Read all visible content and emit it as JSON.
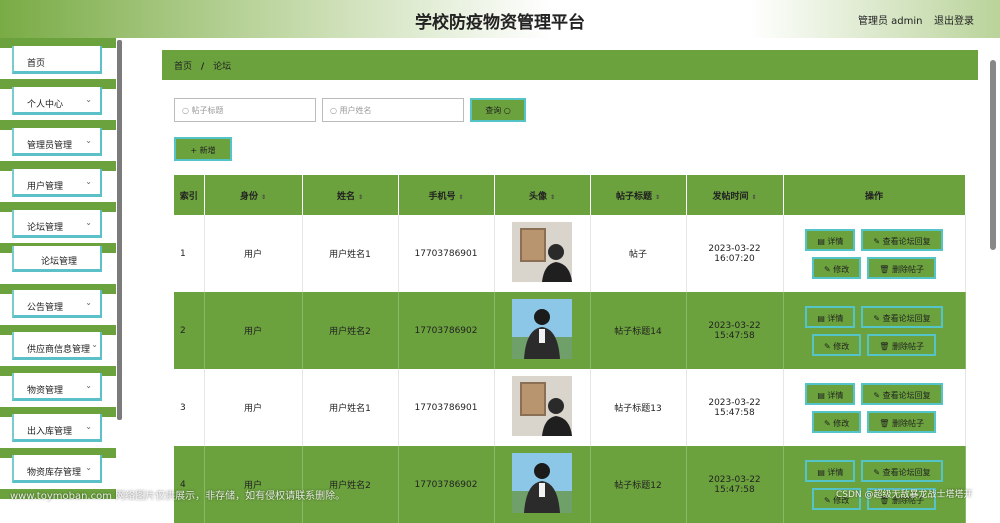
{
  "header": {
    "title": "学校防疫物资管理平台",
    "user": "管理员 admin",
    "logout": "退出登录"
  },
  "sidebar": {
    "items": [
      {
        "label": "首页"
      },
      {
        "label": "个人中心",
        "chev": "⌄"
      },
      {
        "label": "管理员管理",
        "chev": "⌄"
      },
      {
        "label": "用户管理",
        "chev": "⌄"
      },
      {
        "label": "论坛管理",
        "chev": "⌄"
      },
      {
        "label": "论坛管理"
      },
      {
        "label": "公告管理",
        "chev": "⌄"
      },
      {
        "label": "供应商信息管理",
        "chev": "⌄"
      },
      {
        "label": "物资管理",
        "chev": "⌄"
      },
      {
        "label": "出入库管理",
        "chev": "⌄"
      },
      {
        "label": "物资库存管理",
        "chev": "⌄"
      }
    ]
  },
  "breadcrumb": {
    "home": "首页",
    "sep": "/",
    "current": "论坛"
  },
  "search": {
    "title_placeholder": "帖子标题",
    "name_placeholder": "用户姓名",
    "query_label": "查询",
    "add_label": "+ 新增"
  },
  "table": {
    "headers": [
      "索引",
      "身份",
      "姓名",
      "手机号",
      "头像",
      "帖子标题",
      "发帖时间",
      "操作"
    ],
    "sort_icon": "⇕",
    "rows": [
      {
        "index": "1",
        "role": "用户",
        "name": "用户姓名1",
        "phone": "17703786901",
        "title": "帖子",
        "time": "2023-03-22 16:07:20"
      },
      {
        "index": "2",
        "role": "用户",
        "name": "用户姓名2",
        "phone": "17703786902",
        "title": "帖子标题14",
        "time": "2023-03-22 15:47:58"
      },
      {
        "index": "3",
        "role": "用户",
        "name": "用户姓名1",
        "phone": "17703786901",
        "title": "帖子标题13",
        "time": "2023-03-22 15:47:58"
      },
      {
        "index": "4",
        "role": "用户",
        "name": "用户姓名2",
        "phone": "17703786902",
        "title": "帖子标题12",
        "time": "2023-03-22 15:47:58"
      }
    ],
    "actions": {
      "detail": "详情",
      "view_reply": "查看论坛回复",
      "edit": "修改",
      "delete": "删除帖子"
    }
  },
  "watermark": "www.toymoban.com 网络图片仅供展示，非存储，如有侵权请联系删除。",
  "watermark2": "CSDN @超级无敌暴龙战士塔塔开",
  "colors": {
    "accent": "#6ba23d",
    "border": "#55c4c9"
  }
}
